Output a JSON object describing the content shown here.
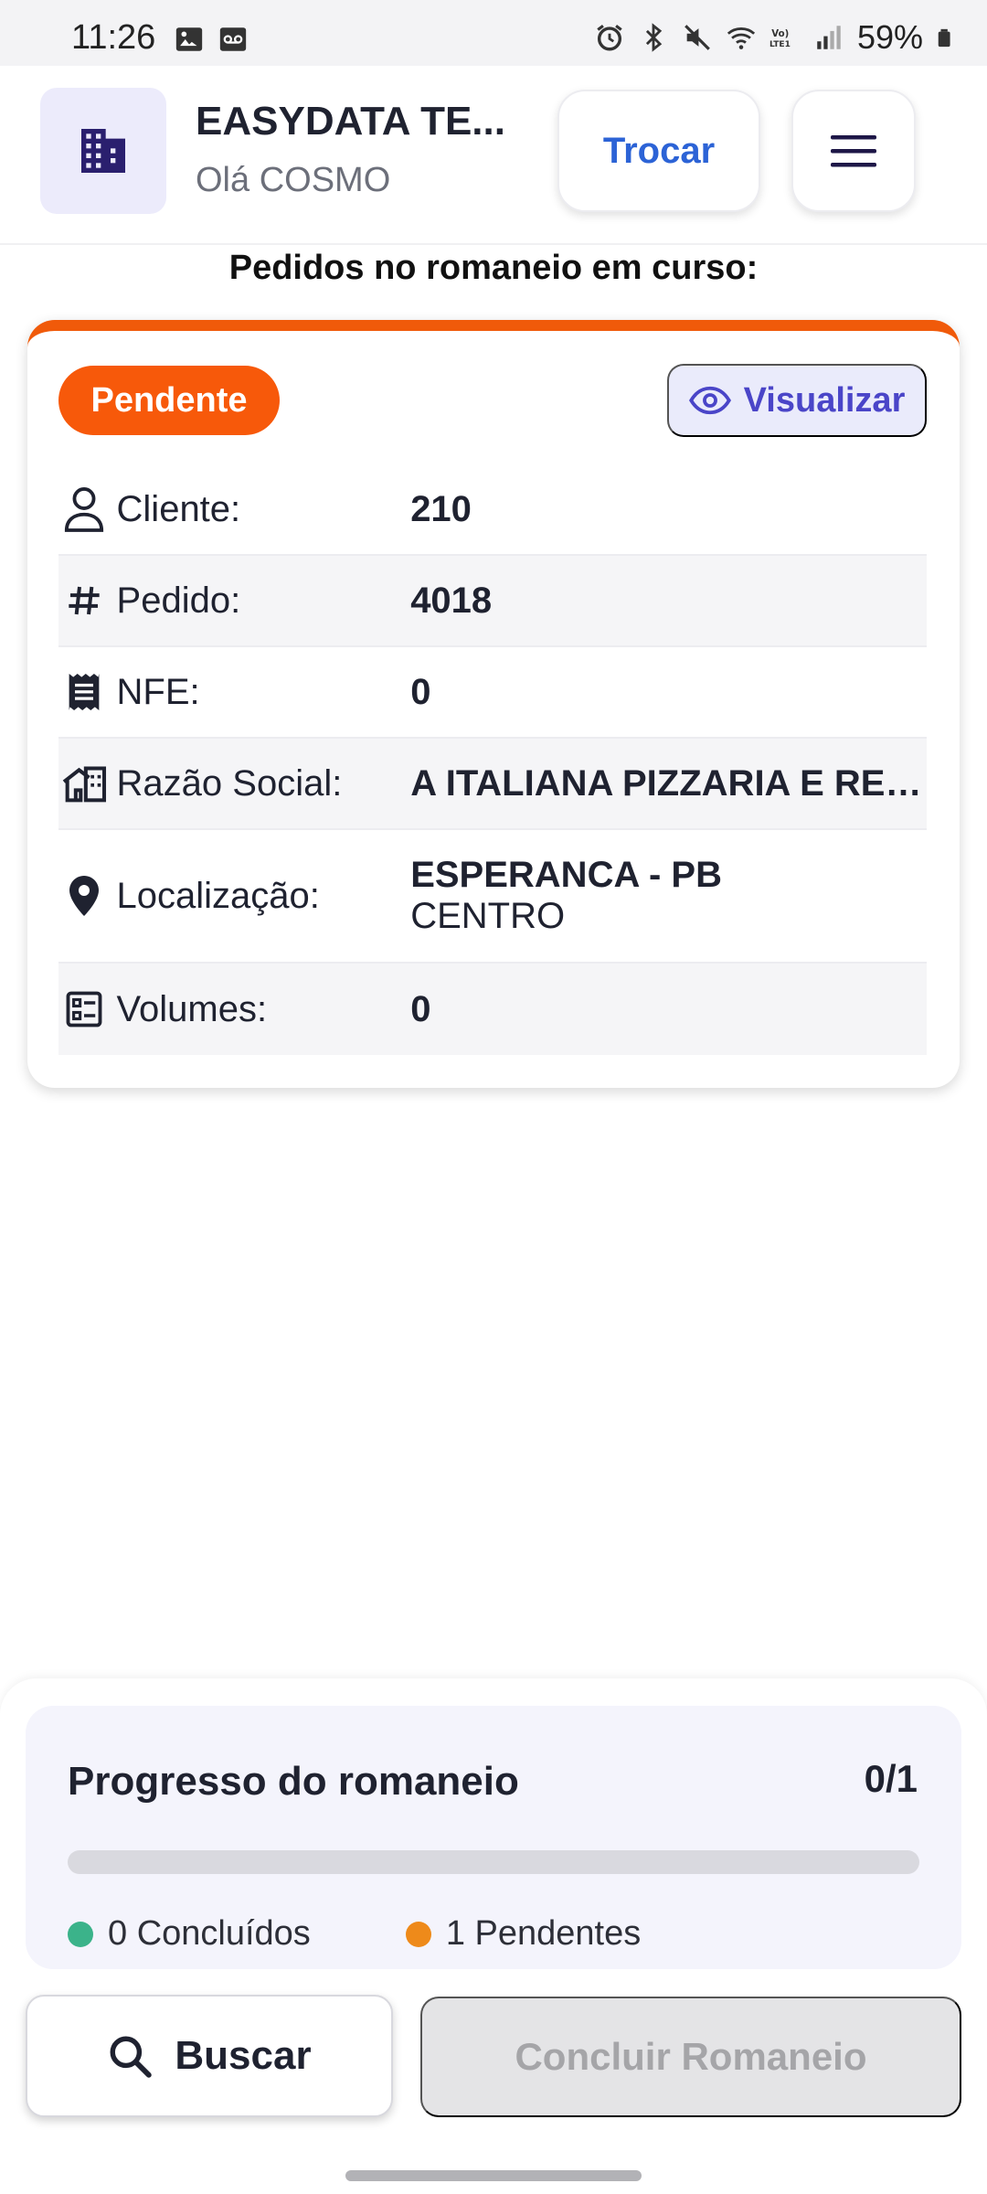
{
  "status_bar": {
    "time": "11:26",
    "battery": "59%",
    "icons": [
      "gallery-icon",
      "voicemail-icon",
      "alarm-icon",
      "bluetooth-icon",
      "mute-icon",
      "wifi-icon",
      "volte-icon",
      "signal-icon",
      "battery-icon"
    ]
  },
  "header": {
    "company": "EASYDATA TE...",
    "greeting": "Olá COSMO",
    "switch_label": "Trocar",
    "brand_color": "#2c63d6",
    "logo_icon": "building-icon",
    "menu_icon": "hamburger-icon"
  },
  "section_title": "Pedidos no romaneio em curso:",
  "order": {
    "status": "Pendente",
    "status_color": "#f7590a",
    "view_label": "Visualizar",
    "fields": {
      "cliente": {
        "label": "Cliente:",
        "value": "210",
        "icon": "user-icon"
      },
      "pedido": {
        "label": "Pedido:",
        "value": "4018",
        "icon": "hash-icon"
      },
      "nfe": {
        "label": "NFE:",
        "value": "0",
        "icon": "receipt-icon"
      },
      "razao": {
        "label": "Razão Social:",
        "value": "A ITALIANA PIZZARIA E RESTA...",
        "icon": "store-icon"
      },
      "localizacao": {
        "label": "Localização:",
        "value": "ESPERANCA - PB",
        "sub_value": "CENTRO",
        "icon": "location-pin-icon"
      },
      "volumes": {
        "label": "Volumes:",
        "value": "0",
        "icon": "checklist-icon"
      }
    }
  },
  "progress": {
    "title": "Progresso do romaneio",
    "count": "0/1",
    "fraction": 0,
    "done_label": "0 Concluídos",
    "pending_label": "1 Pendentes",
    "done_color": "#3bb38a",
    "pending_color": "#ee8a1a"
  },
  "actions": {
    "search_label": "Buscar",
    "finish_label": "Concluir Romaneio"
  }
}
